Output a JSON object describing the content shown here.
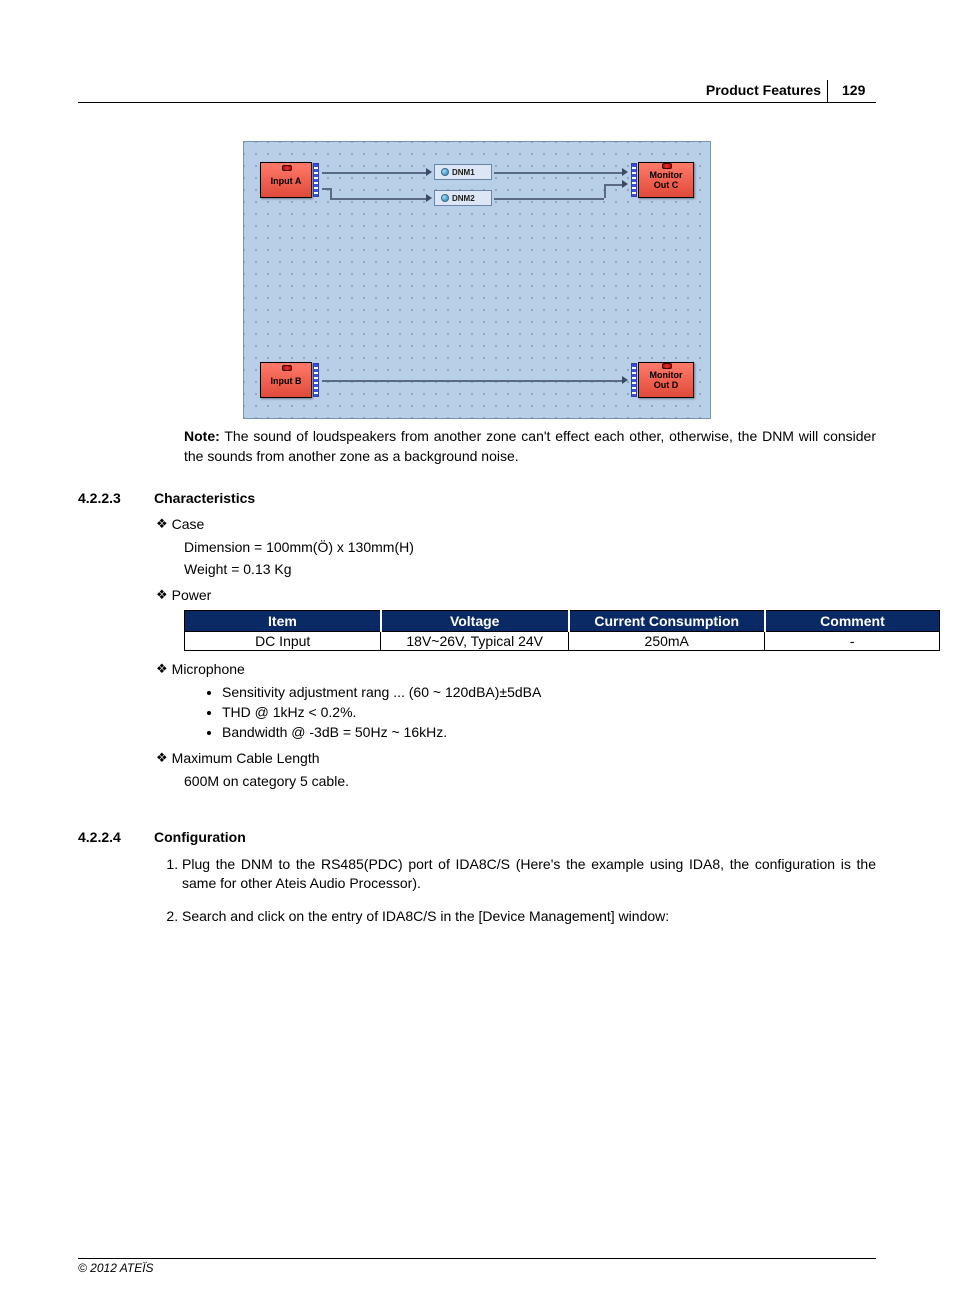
{
  "header": {
    "title": "Product Features",
    "page_number": "129"
  },
  "diagram": {
    "blocks": {
      "input_a": "Input A",
      "input_b": "Input B",
      "monitor_c_line1": "Monitor",
      "monitor_c_line2": "Out C",
      "monitor_d_line1": "Monitor",
      "monitor_d_line2": "Out D",
      "dnm1": "DNM1",
      "dnm2": "DNM2"
    }
  },
  "note": {
    "label": "Note:",
    "text": " The sound of loudspeakers from another zone can't effect each other, otherwise, the DNM will consider the sounds from another zone as a background noise."
  },
  "sec_characteristics": {
    "num": "4.2.2.3",
    "title": "Characteristics",
    "case_h": "Case",
    "case_dim": "Dimension = 100mm(Ö) x 130mm(H)",
    "case_weight": "Weight = 0.13 Kg",
    "power_h": "Power",
    "power_table": {
      "headers": [
        "Item",
        "Voltage",
        "Current Consumption",
        "Comment"
      ],
      "row": [
        "DC Input",
        "18V~26V, Typical 24V",
        "250mA",
        "-"
      ]
    },
    "mic_h": "Microphone",
    "mic_items": [
      "Sensitivity adjustment rang ... (60 ~ 120dBA)±5dBA",
      "THD @ 1kHz < 0.2%.",
      "Bandwidth @ -3dB = 50Hz ~ 16kHz."
    ],
    "cable_h": "Maximum Cable Length",
    "cable_text": "600M on category 5 cable."
  },
  "sec_config": {
    "num": "4.2.2.4",
    "title": "Configuration",
    "steps": [
      "Plug the DNM to the RS485(PDC) port of IDA8C/S (Here's the example using IDA8, the configuration is the same for other Ateis Audio Processor).",
      "Search and click on the entry of IDA8C/S in the [Device Management] window:"
    ]
  },
  "footer": "© 2012 ATEÏS"
}
